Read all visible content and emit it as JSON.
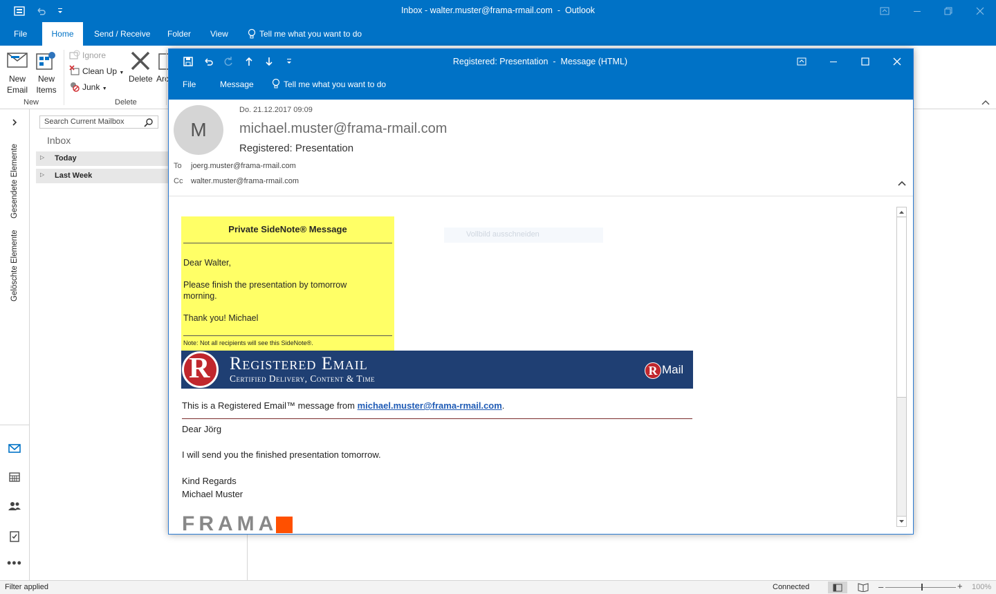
{
  "window": {
    "title": "Inbox - walter.muster@frama-rmail.com  -  Outlook"
  },
  "menu": {
    "file": "File",
    "home": "Home",
    "send_receive": "Send / Receive",
    "folder": "Folder",
    "view": "View",
    "tell_me": "Tell me what you want to do"
  },
  "ribbon": {
    "new_email_1": "New",
    "new_email_2": "Email",
    "new_items_1": "New",
    "new_items_2": "Items",
    "ignore": "Ignore",
    "clean_up": "Clean Up",
    "junk": "Junk",
    "delete": "Delete",
    "archive": "Arc",
    "group_new": "New",
    "group_delete": "Delete"
  },
  "nav": {
    "sent": "Gesendete Elemente",
    "deleted": "Gelöschte Elemente"
  },
  "folder": {
    "search_placeholder": "Search Current Mailbox",
    "inbox": "Inbox",
    "groups": [
      "Today",
      "Last Week"
    ]
  },
  "status": {
    "filter": "Filter applied",
    "connected": "Connected",
    "zoom": "100%"
  },
  "message": {
    "title": "Registered: Presentation  -  Message (HTML)",
    "menu": {
      "file": "File",
      "message": "Message",
      "tell_me": "Tell me what you want to do"
    },
    "avatar_letter": "M",
    "date": "Do. 21.12.2017 09:09",
    "from": "michael.muster@frama-rmail.com",
    "subject": "Registered: Presentation",
    "to_label": "To",
    "to": "joerg.muster@frama-rmail.com",
    "cc_label": "Cc",
    "cc": "walter.muster@frama-rmail.com",
    "sidenote": {
      "title": "Private SideNote® Message",
      "greeting": "Dear Walter,",
      "line1": "Please finish the presentation by tomorrow",
      "line2": "morning.",
      "thanks": "Thank you! Michael",
      "note": "Note: Not all recipients will see this SideNote®."
    },
    "overlay_text": "Vollbild ausschneiden",
    "banner": {
      "title": "Registered Email",
      "subtitle": "Certified Delivery, Content & Time",
      "logo_letter": "R",
      "logo_text": "Mail"
    },
    "intro_prefix": "This is a Registered Email™ message from ",
    "intro_link": "michael.muster@frama-rmail.com",
    "intro_suffix": ".",
    "body": {
      "greeting": "Dear Jörg",
      "line1": "I will send you the finished presentation tomorrow.",
      "regards": "Kind Regards",
      "name": "Michael Muster"
    },
    "footer_logo": "FRAMA"
  },
  "colors": {
    "accent": "#0072c6",
    "sidenote": "#ffff66",
    "banner": "#1f3f73",
    "logo_red": "#c0272d",
    "frama_orange": "#ff5000"
  }
}
